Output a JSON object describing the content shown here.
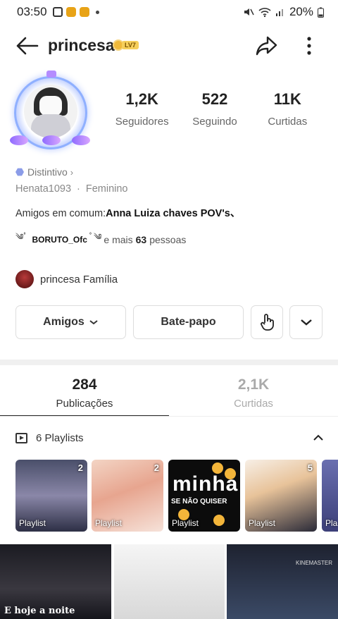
{
  "statusbar": {
    "time": "03:50",
    "battery": "20%"
  },
  "header": {
    "profile_name": "princesa",
    "level": "LV7"
  },
  "stats": [
    {
      "value": "1,2K",
      "label": "Seguidores"
    },
    {
      "value": "522",
      "label": "Seguindo"
    },
    {
      "value": "11K",
      "label": "Curtidas"
    }
  ],
  "badge": {
    "label": "Distintivo",
    "chevron": "›"
  },
  "meta": {
    "username": "Henata1093",
    "separator": "·",
    "gender": "Feminino"
  },
  "mutual": {
    "prefix": "Amigos em comum:",
    "names": "Anna Luiza chaves POV's、"
  },
  "friends_line": {
    "deco_left": "༄ﾟ",
    "friend": "BORUTO_Ofc",
    "deco_right": "ﾟ༄",
    "more_prefix": "e mais",
    "more_count": "63",
    "more_suffix": "pessoas"
  },
  "family": {
    "label": "princesa Família"
  },
  "buttons": {
    "friends": "Amigos",
    "chat": "Bate-papo"
  },
  "tabs": [
    {
      "value": "284",
      "label": "Publicações",
      "active": true
    },
    {
      "value": "2,1K",
      "label": "Curtidas",
      "active": false
    }
  ],
  "playlists": {
    "title": "6 Playlists",
    "cards": [
      {
        "label": "Playlist",
        "count": "2"
      },
      {
        "label": "Playlist",
        "count": "2"
      },
      {
        "label": "Playlist",
        "count": "",
        "overlay_text": "minha",
        "overlay_sub": "SE NÃO QUISER"
      },
      {
        "label": "Playlist",
        "count": "5"
      },
      {
        "label": "Pla",
        "count": ""
      }
    ]
  },
  "posts": [
    {
      "caption": "E hoje a noite"
    },
    {
      "caption": ""
    },
    {
      "caption": "",
      "watermark": "KINEMASTER"
    }
  ],
  "icons": {
    "back": "arrow-left-icon",
    "share": "share-icon",
    "more": "more-vertical-icon",
    "hand": "hand-point-icon",
    "dropdown": "chevron-down-icon",
    "playlist": "playlist-icon",
    "collapse": "chevron-up-icon"
  }
}
